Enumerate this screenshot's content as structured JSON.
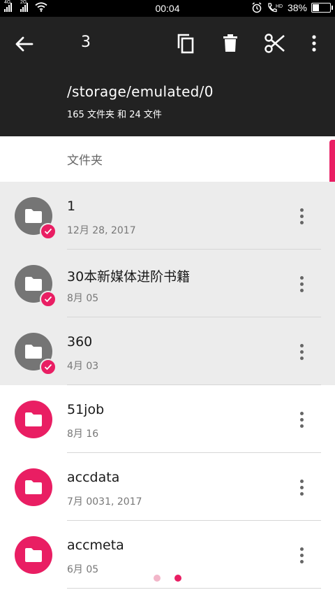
{
  "status_bar": {
    "sim1_tag": "4G",
    "sim2_tag": "2G",
    "time": "00:04",
    "battery": "38%",
    "battery_level": 0.38,
    "icons": [
      "alarm-icon",
      "hd-call-icon",
      "battery-icon",
      "wifi-icon"
    ]
  },
  "app_bar": {
    "selected_count": "3",
    "path": "/storage/emulated/0",
    "summary": "165 文件夹 和 24 文件",
    "actions": [
      "copy-icon",
      "delete-icon",
      "cut-icon",
      "more-vert-icon"
    ]
  },
  "section": {
    "title": "文件夹"
  },
  "files": [
    {
      "name": "1",
      "date": "12月 28, 2017",
      "selected": true
    },
    {
      "name": "30本新媒体进阶书籍",
      "date": "8月 05",
      "selected": true
    },
    {
      "name": "360",
      "date": "4月 03",
      "selected": true
    },
    {
      "name": "51job",
      "date": "8月 16",
      "selected": false
    },
    {
      "name": "accdata",
      "date": "7月 0031, 2017",
      "selected": false
    },
    {
      "name": "accmeta",
      "date": "6月 05",
      "selected": false
    }
  ],
  "pager": {
    "pages": 2,
    "current": 2
  },
  "colors": {
    "accent": "#e91e63",
    "appbar": "#222222",
    "selected_row": "#ececec",
    "folder_grey": "#757575"
  }
}
